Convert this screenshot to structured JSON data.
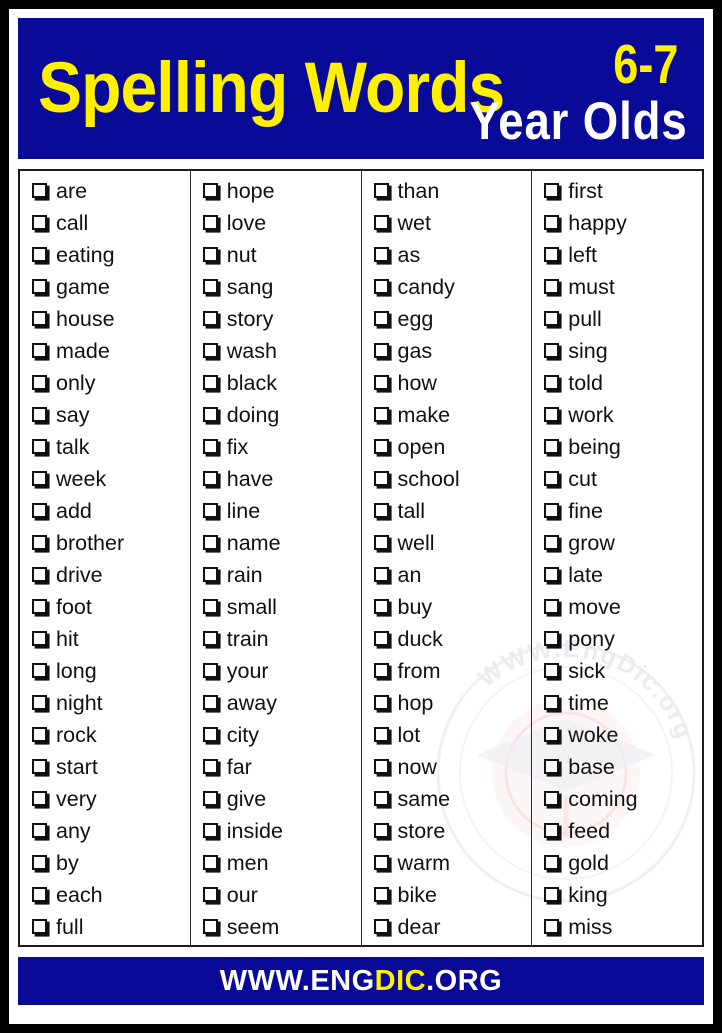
{
  "colors": {
    "banner_blue": "#0a0a99",
    "accent_yellow": "#ffef00",
    "text_white": "#ffffff",
    "word_black": "#111111",
    "border_black": "#000000"
  },
  "header": {
    "title": "Spelling Words",
    "age_range": "6-7",
    "age_label": "Year Olds"
  },
  "list": {
    "checkbox_icon": "checkbox-empty-icon",
    "column_count": 4,
    "rows_per_column": 24,
    "total_words": 96,
    "columns": [
      {
        "index": 1,
        "words": [
          "are",
          "call",
          "eating",
          "game",
          "house",
          "made",
          "only",
          "say",
          "talk",
          "week",
          "add",
          "brother",
          "drive",
          "foot",
          "hit",
          "long",
          "night",
          "rock",
          "start",
          "very",
          "any",
          "by",
          "each",
          "full"
        ]
      },
      {
        "index": 2,
        "words": [
          "hope",
          "love",
          "nut",
          "sang",
          "story",
          "wash",
          "black",
          "doing",
          "fix",
          "have",
          "line",
          "name",
          "rain",
          "small",
          "train",
          "your",
          "away",
          "city",
          "far",
          "give",
          "inside",
          "men",
          "our",
          "seem"
        ]
      },
      {
        "index": 3,
        "words": [
          "than",
          "wet",
          "as",
          "candy",
          "egg",
          "gas",
          "how",
          "make",
          "open",
          "school",
          "tall",
          "well",
          "an",
          "buy",
          "duck",
          "from",
          "hop",
          "lot",
          "now",
          "same",
          "store",
          "warm",
          "bike",
          "dear"
        ]
      },
      {
        "index": 4,
        "words": [
          "first",
          "happy",
          "left",
          "must",
          "pull",
          "sing",
          "told",
          "work",
          "being",
          "cut",
          "fine",
          "grow",
          "late",
          "move",
          "pony",
          "sick",
          "time",
          "woke",
          "base",
          "coming",
          "feed",
          "gold",
          "king",
          "miss"
        ]
      }
    ]
  },
  "watermark": {
    "text": "WWW.EngDic.org"
  },
  "footer": {
    "url_prefix": "WWW.ENG",
    "url_highlight": "DIC",
    "url_suffix": ".ORG"
  }
}
